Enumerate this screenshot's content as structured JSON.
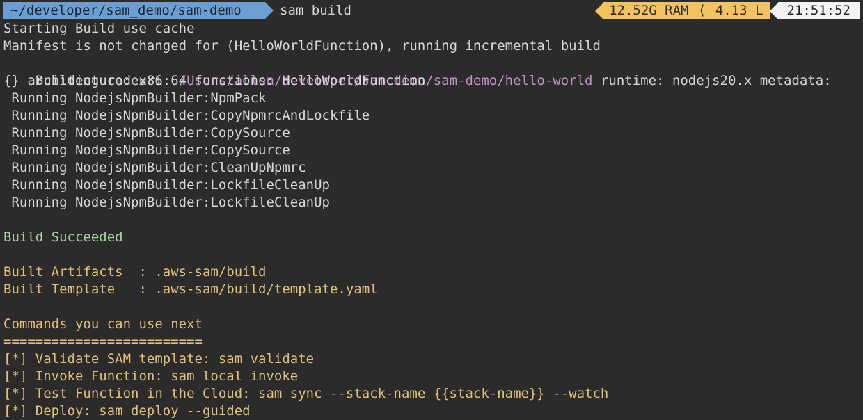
{
  "prompt": {
    "path": "~/developer/sam_demo/sam-demo",
    "command": "sam build",
    "status": {
      "ram": "12.52G RAM",
      "load": "4.13 L",
      "time": "21:51:52"
    }
  },
  "output": {
    "line1": "Starting Build use cache",
    "line2": "Manifest is not changed for (HelloWorldFunction), running incremental build",
    "line3_prefix": "Building codeuri: ",
    "line3_path": "/Users/allen/developer/sam_demo/sam-demo/hello-world",
    "line3_suffix": " runtime: nodejs20.x metadata:",
    "line4": "{} architecture: x86_64 functions: HelloWorldFunction",
    "running": [
      " Running NodejsNpmBuilder:NpmPack",
      " Running NodejsNpmBuilder:CopyNpmrcAndLockfile",
      " Running NodejsNpmBuilder:CopySource",
      " Running NodejsNpmBuilder:CopySource",
      " Running NodejsNpmBuilder:CleanUpNpmrc",
      " Running NodejsNpmBuilder:LockfileCleanUp",
      " Running NodejsNpmBuilder:LockfileCleanUp"
    ],
    "build_succeeded": "Build Succeeded",
    "built_artifacts": "Built Artifacts  : .aws-sam/build",
    "built_template": "Built Template   : .aws-sam/build/template.yaml",
    "commands_title": "Commands you can use next",
    "commands_rule": "=========================",
    "commands": [
      "[*] Validate SAM template: sam validate",
      "[*] Invoke Function: sam local invoke",
      "[*] Test Function in the Cloud: sam sync --stack-name {{stack-name}} --watch",
      "[*] Deploy: sam deploy --guided"
    ]
  },
  "colors": {
    "background": "#2b2b2b",
    "path_segment": "#6b9fd4",
    "status_segment": "#f3c35f",
    "clock_segment": "#f3f3f3",
    "success": "#a8d3a1",
    "highlight": "#e5c07b",
    "path_text": "#c58fc9"
  },
  "icons": {
    "path_separator": "powerline-right-arrow-icon",
    "status_separator": "powerline-left-arrow-icon"
  }
}
